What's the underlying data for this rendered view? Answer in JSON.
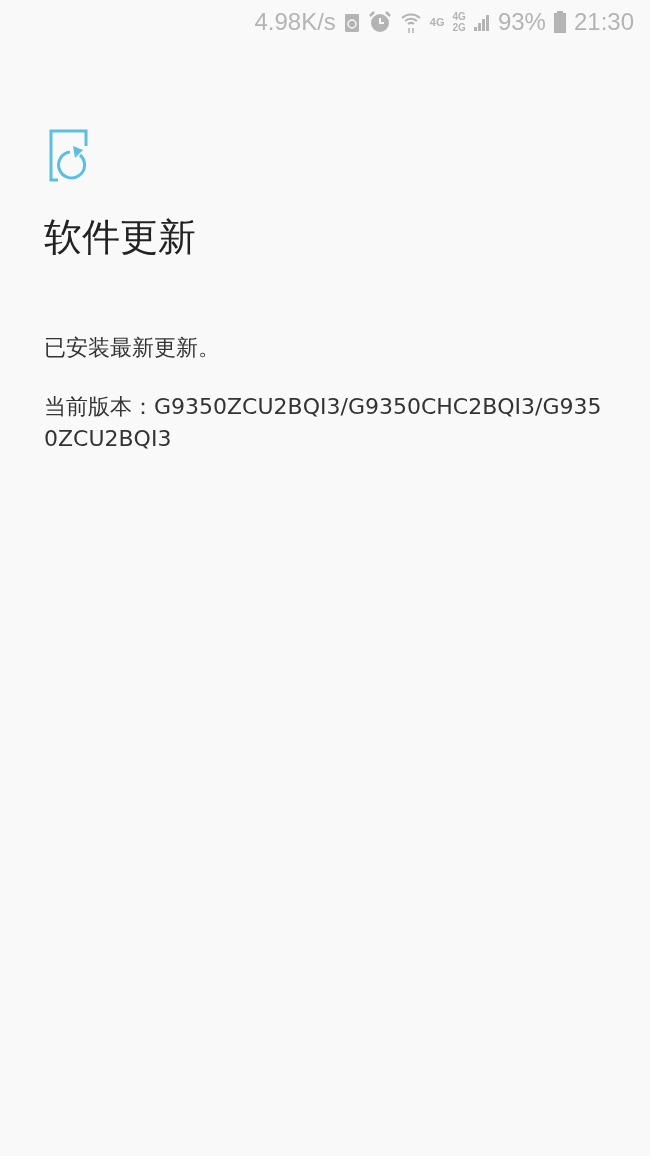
{
  "status_bar": {
    "speed": "4.98K/s",
    "network_1": "4G",
    "network_2_top": "4G",
    "network_2_bottom": "2G",
    "battery": "93%",
    "time": "21:30"
  },
  "title": "软件更新",
  "message": "已安装最新更新。",
  "version": "当前版本：G9350ZCU2BQI3/G9350CHC2BQI3/G9350ZCU2BQI3"
}
